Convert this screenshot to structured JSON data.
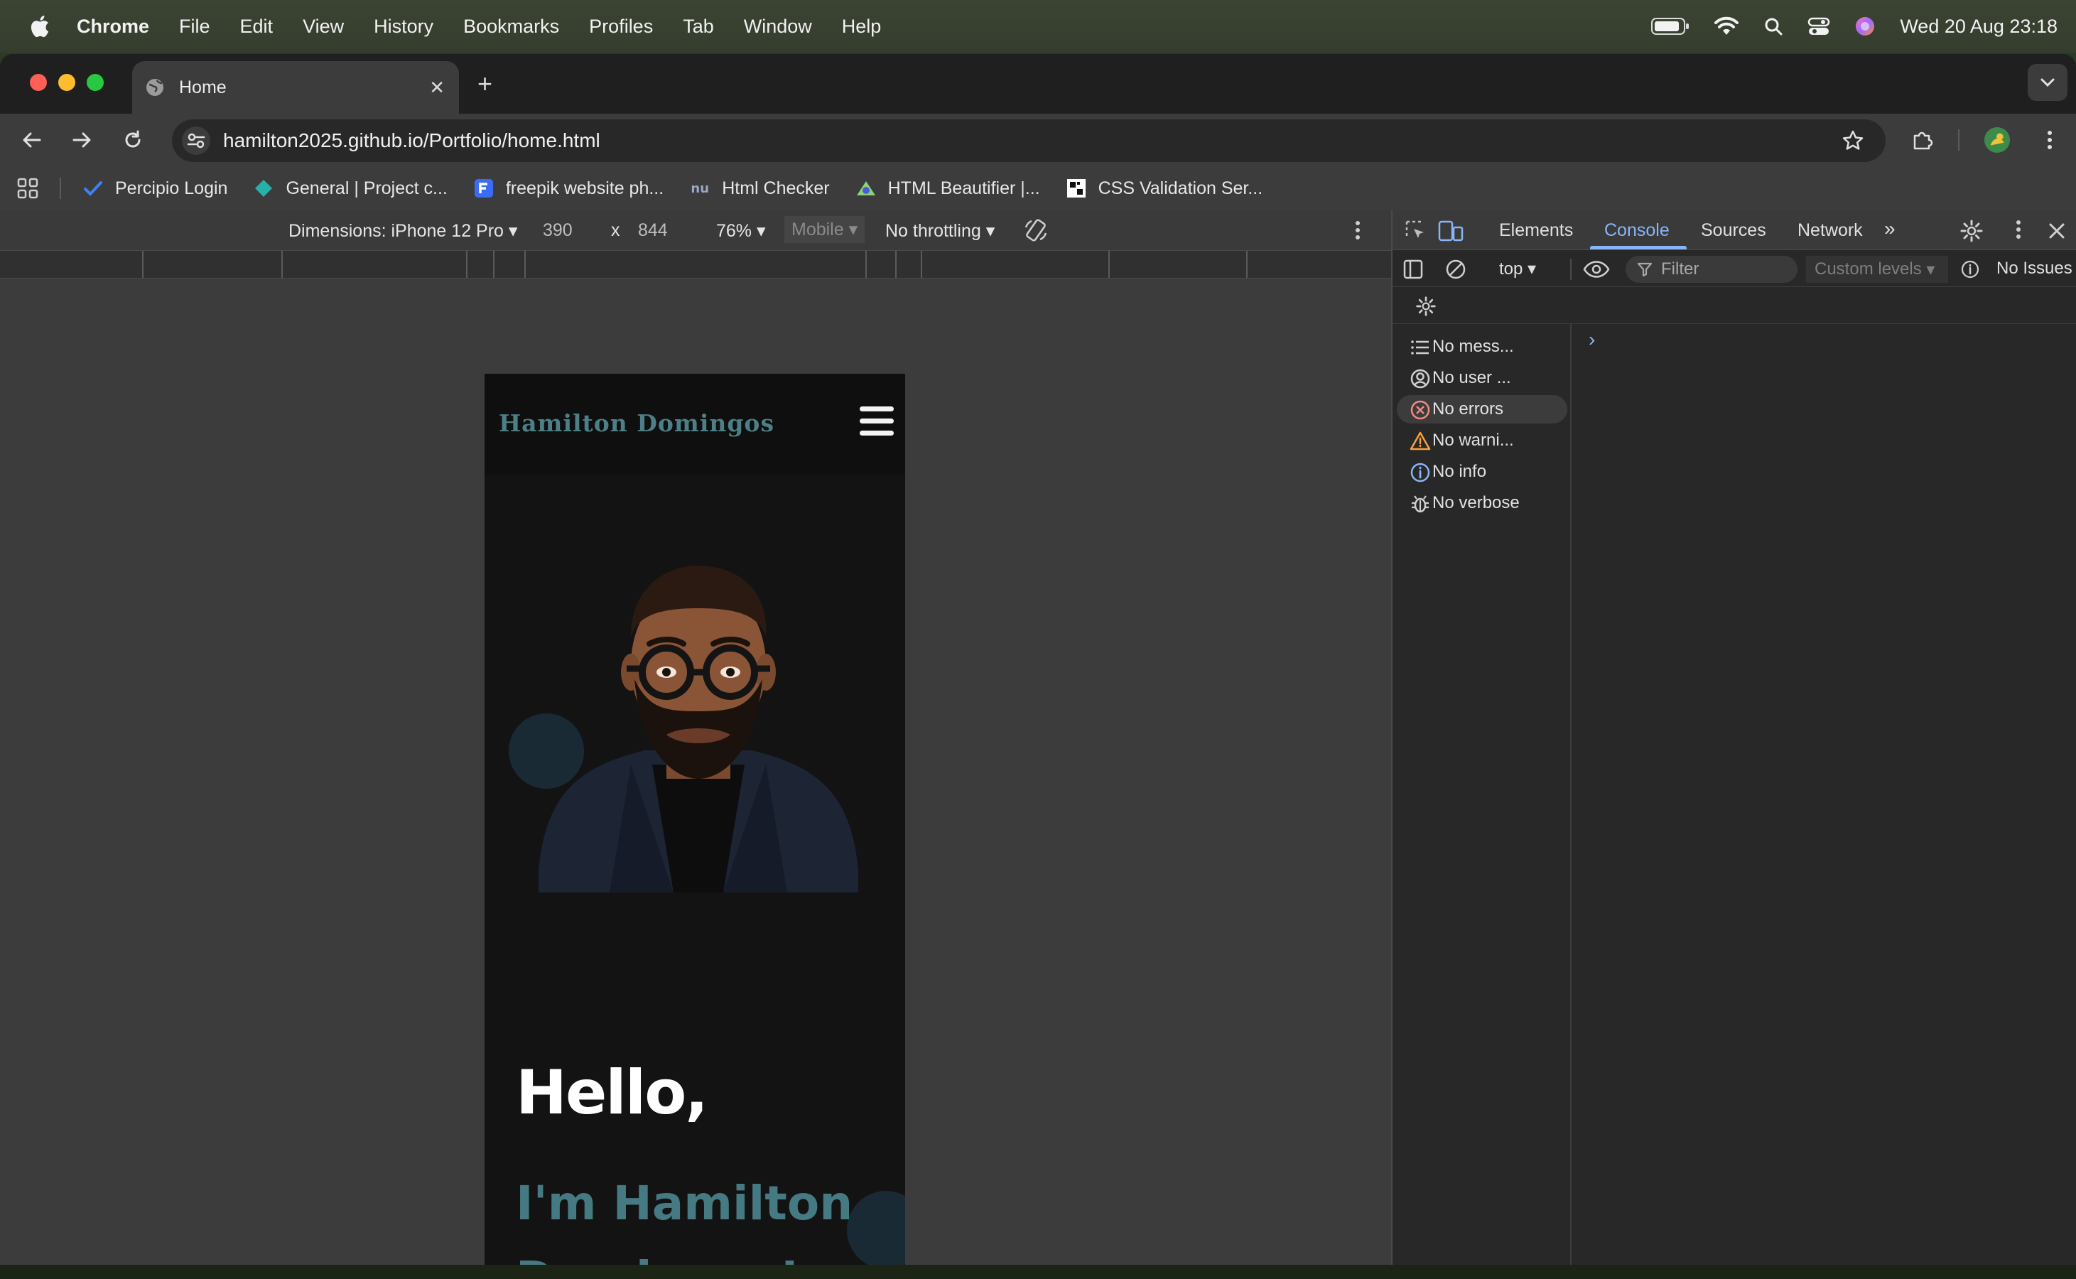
{
  "menubar": {
    "app": "Chrome",
    "items": [
      "File",
      "Edit",
      "View",
      "History",
      "Bookmarks",
      "Profiles",
      "Tab",
      "Window",
      "Help"
    ],
    "clock": "Wed 20 Aug  23:18"
  },
  "tab": {
    "title": "Home"
  },
  "omnibox": {
    "url": "hamilton2025.github.io/Portfolio/home.html"
  },
  "bookmarks": [
    {
      "label": "Percipio Login",
      "icon": "check-icon",
      "color": "#3b82f6"
    },
    {
      "label": "General | Project c...",
      "icon": "diamond-icon",
      "color": "#26b0a8"
    },
    {
      "label": "freepik website ph...",
      "icon": "freepik-icon",
      "color": "#3b6cf6"
    },
    {
      "label": "Html Checker",
      "icon": "nu-icon",
      "color": "#9aa5c8"
    },
    {
      "label": "HTML Beautifier |...",
      "icon": "beautifier-icon",
      "color": "#8bd17c"
    },
    {
      "label": "CSS Validation Ser...",
      "icon": "w3c-icon",
      "color": "#ffffff"
    }
  ],
  "device_toolbar": {
    "dimensions_label": "Dimensions: iPhone 12 Pro",
    "width": "390",
    "times": "x",
    "height": "844",
    "zoom": "76%",
    "mobile": "Mobile",
    "throttling": "No throttling"
  },
  "site": {
    "logo": "Hamilton Domingos",
    "hello": "Hello,",
    "intro": "I'm  Hamilton Domingos!"
  },
  "devtools": {
    "tabs": [
      "Elements",
      "Console",
      "Sources",
      "Network"
    ],
    "active_tab": "Console",
    "context": "top",
    "filter_placeholder": "Filter",
    "levels": "Custom levels",
    "issues": "No Issues",
    "sidebar": [
      {
        "label": "No mess...",
        "icon": "list-icon"
      },
      {
        "label": "No user ...",
        "icon": "user-icon"
      },
      {
        "label": "No errors",
        "icon": "error-icon"
      },
      {
        "label": "No warni...",
        "icon": "warning-icon"
      },
      {
        "label": "No info",
        "icon": "info-icon"
      },
      {
        "label": "No verbose",
        "icon": "bug-icon"
      }
    ],
    "prompt": ">"
  },
  "colors": {
    "accent": "#8ab4f8",
    "logo": "#4c7f86",
    "intro": "#467a82",
    "error": "#f28b82",
    "warning": "#fdd663"
  }
}
